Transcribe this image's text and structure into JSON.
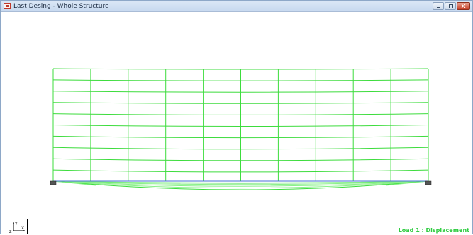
{
  "window": {
    "title": "Last Desing - Whole Structure",
    "icon": "structure-window-icon"
  },
  "viewport": {
    "status_label": "Load 1 : Displacement",
    "axis_triad": {
      "vertical_label": "Y",
      "horizontal_label": "X",
      "depth_label": "Z"
    },
    "colors": {
      "mesh": "#3ddc3d",
      "mesh_light": "#8af08a",
      "deflection": "#3ddc3d",
      "support": "#555555",
      "status": "#2ecc40"
    },
    "structure": {
      "columns": 11,
      "rows": 11,
      "supports": 2
    }
  }
}
